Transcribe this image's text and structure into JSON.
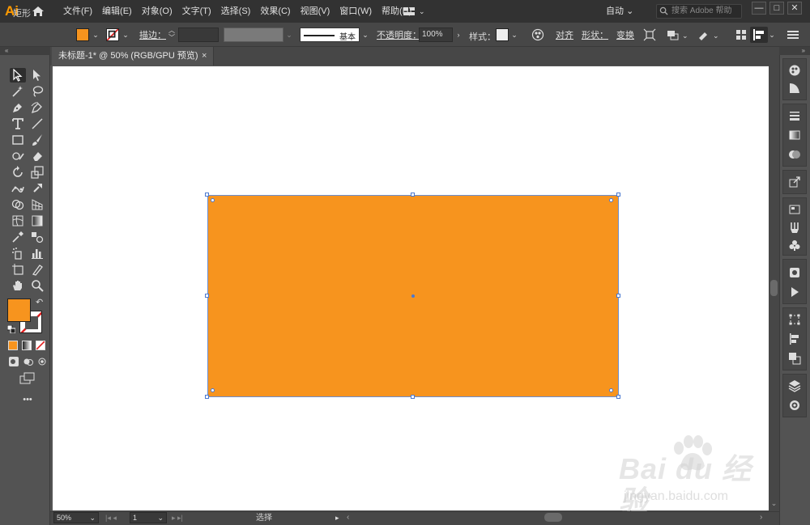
{
  "app": {
    "logo_text": "Ai",
    "menus": [
      "文件(F)",
      "编辑(E)",
      "对象(O)",
      "文字(T)",
      "选择(S)",
      "效果(C)",
      "视图(V)",
      "窗口(W)",
      "帮助(H)"
    ],
    "workspace": "自动",
    "search_placeholder": "搜索 Adobe 帮助",
    "window_buttons": {
      "minimize": "—",
      "maximize": "□",
      "close": "✕"
    }
  },
  "control_bar": {
    "selection_type": "矩形",
    "fill_color": "#f7941e",
    "stroke_label": "描边：",
    "stroke_profile": "基本",
    "opacity_label": "不透明度：",
    "opacity_value": "100%",
    "style_label": "样式：",
    "align_label": "对齐",
    "shape_label": "形状：",
    "transform_label": "变换"
  },
  "document": {
    "tab_title": "未标题-1* @ 50% (RGB/GPU 预览)",
    "tab_close": "×"
  },
  "canvas": {
    "artboard_color": "#ffffff",
    "rectangle_fill": "#f7941e",
    "selection_color": "#4a78d0"
  },
  "toolbar": {
    "fill_swatch_color": "#f7941e",
    "tools": [
      "selection-tool",
      "direct-selection-tool",
      "magic-wand-tool",
      "lasso-tool",
      "pen-tool",
      "curvature-tool",
      "type-tool",
      "line-segment-tool",
      "rectangle-tool",
      "paintbrush-tool",
      "shaper-tool",
      "eraser-tool",
      "rotate-tool",
      "scale-tool",
      "puppet-warp-tool",
      "free-transform-tool",
      "shape-builder-tool",
      "perspective-grid-tool",
      "mesh-tool",
      "gradient-tool",
      "eyedropper-tool",
      "blend-tool",
      "symbol-sprayer-tool",
      "column-graph-tool",
      "artboard-tool",
      "slice-tool",
      "hand-tool",
      "zoom-tool"
    ],
    "more_label": "•••"
  },
  "status_bar": {
    "zoom": "50%",
    "page": "1",
    "status": "选择"
  },
  "right_panels": [
    "color-icon",
    "color-guide-icon",
    "stroke-icon",
    "gradient-icon",
    "transparency-icon",
    "asset-export-icon",
    "libraries-icon",
    "brushes-icon",
    "symbols-icon",
    "cc-libraries-icon",
    "actions-icon",
    "transform-icon",
    "align-icon",
    "pathfinder-icon",
    "layers-icon",
    "appearance-icon"
  ],
  "watermark": {
    "logo": "Bai du 经验",
    "url": "jingyan.baidu.com"
  }
}
